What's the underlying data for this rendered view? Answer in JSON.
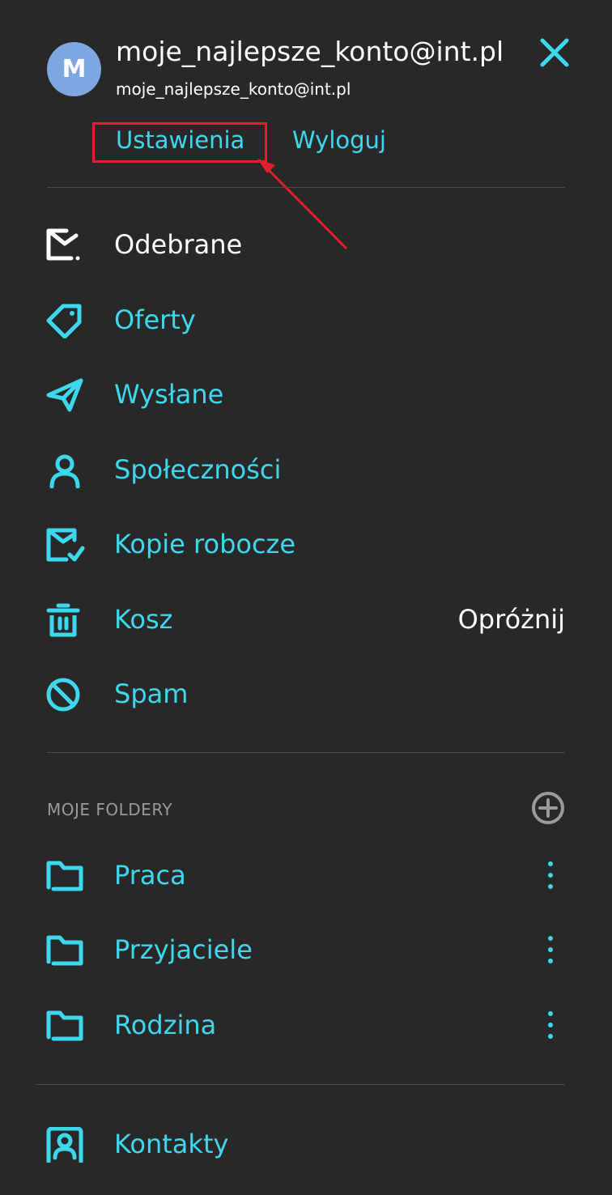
{
  "account": {
    "avatar_letter": "M",
    "name": "moje_najlepsze_konto@int.pl",
    "email": "moje_najlepsze_konto@int.pl",
    "settings_label": "Ustawienia",
    "logout_label": "Wyloguj"
  },
  "menu": {
    "items": [
      {
        "label": "Odebrane",
        "icon": "inbox-icon"
      },
      {
        "label": "Oferty",
        "icon": "tag-icon"
      },
      {
        "label": "Wysłane",
        "icon": "send-icon"
      },
      {
        "label": "Społeczności",
        "icon": "community-icon"
      },
      {
        "label": "Kopie robocze",
        "icon": "draft-icon"
      },
      {
        "label": "Kosz",
        "icon": "trash-icon",
        "action_label": "Opróżnij"
      },
      {
        "label": "Spam",
        "icon": "spam-icon"
      }
    ]
  },
  "folders": {
    "section_title": "MOJE FOLDERY",
    "items": [
      {
        "label": "Praca",
        "icon": "folder-icon"
      },
      {
        "label": "Przyjaciele",
        "icon": "folder-icon"
      },
      {
        "label": "Rodzina",
        "icon": "folder-icon"
      }
    ]
  },
  "footer": {
    "contacts_label": "Kontakty",
    "icon": "contacts-icon"
  },
  "colors": {
    "background": "#282828",
    "accent": "#3ed8ee",
    "highlight": "#e0202e",
    "avatar": "#7ea6e0",
    "muted": "#9a9a9a"
  }
}
